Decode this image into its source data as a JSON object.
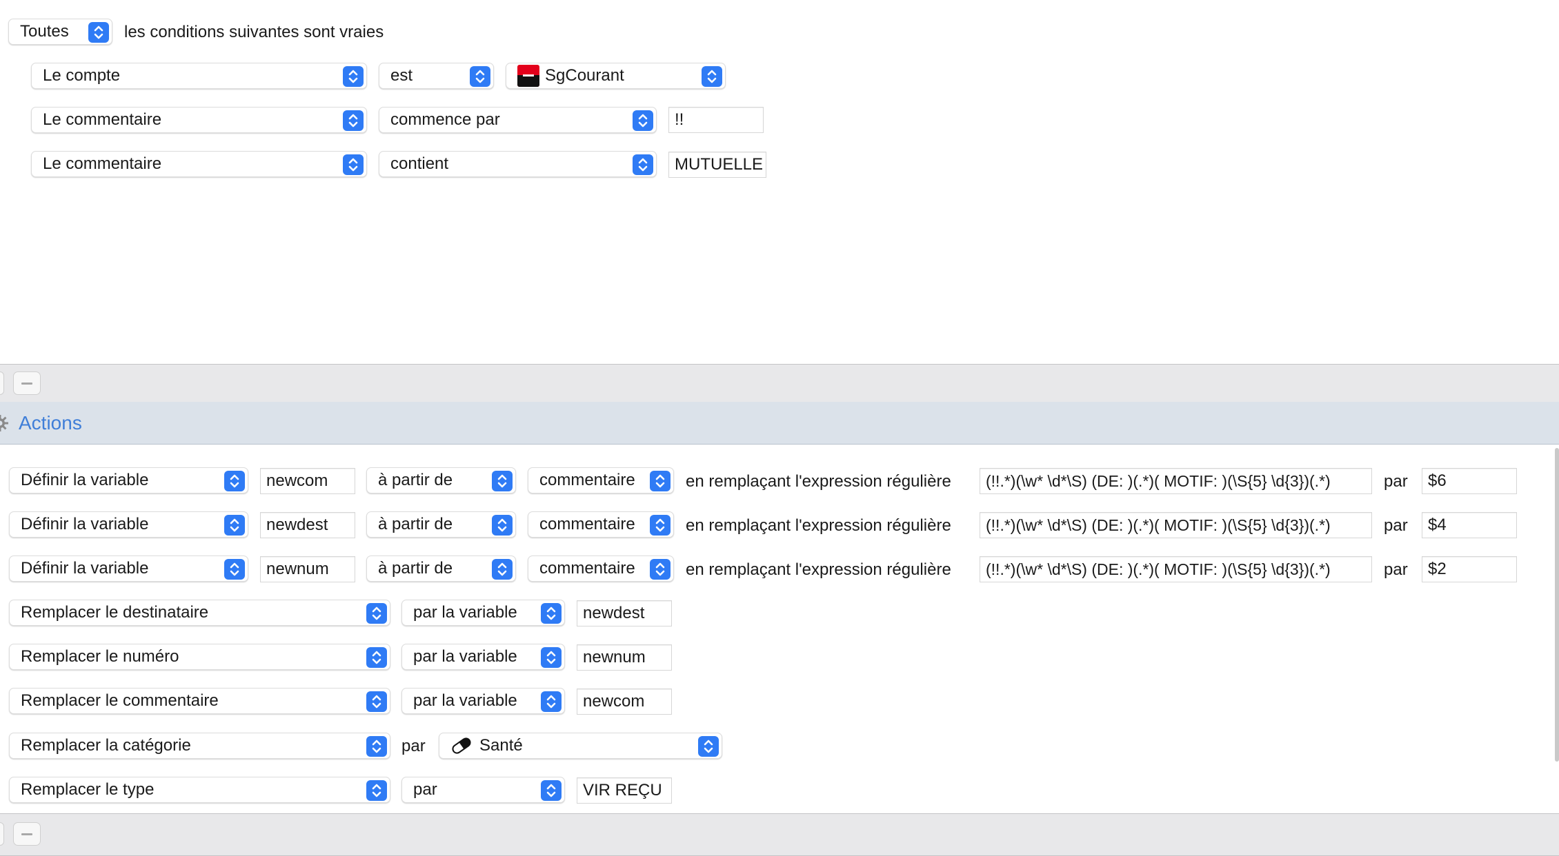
{
  "conditions": {
    "match_mode": "Toutes",
    "match_text": "les conditions suivantes sont vraies",
    "rows": [
      {
        "field": "Le compte",
        "operator": "est",
        "value": "SgCourant"
      },
      {
        "field": "Le commentaire",
        "operator": "commence par",
        "value": "!!"
      },
      {
        "field": "Le commentaire",
        "operator": "contient",
        "value": "MUTUELLE"
      }
    ]
  },
  "actions": {
    "title": "Actions",
    "variable_rows": [
      {
        "action": "Définir la variable",
        "name": "newcom",
        "source_mode": "à partir de",
        "source": "commentaire",
        "regex_label": "en remplaçant l'expression régulière",
        "regex": "(!!.*)(\\w* \\d*\\S) (DE: )(.*)( MOTIF: )(\\S{5} \\d{3})(.*)",
        "par_label": "par",
        "replacement": "$6"
      },
      {
        "action": "Définir la variable",
        "name": "newdest",
        "source_mode": "à partir de",
        "source": "commentaire",
        "regex_label": "en remplaçant l'expression régulière",
        "regex": "(!!.*)(\\w* \\d*\\S) (DE: )(.*)( MOTIF: )(\\S{5} \\d{3})(.*)",
        "par_label": "par",
        "replacement": "$4"
      },
      {
        "action": "Définir la variable",
        "name": "newnum",
        "source_mode": "à partir de",
        "source": "commentaire",
        "regex_label": "en remplaçant l'expression régulière",
        "regex": "(!!.*)(\\w* \\d*\\S) (DE: )(.*)( MOTIF: )(\\S{5} \\d{3})(.*)",
        "par_label": "par",
        "replacement": "$2"
      }
    ],
    "replace_rows": [
      {
        "action": "Remplacer le destinataire",
        "mode": "par la variable",
        "value": "newdest"
      },
      {
        "action": "Remplacer le numéro",
        "mode": "par la variable",
        "value": "newnum"
      },
      {
        "action": "Remplacer le commentaire",
        "mode": "par la variable",
        "value": "newcom"
      }
    ],
    "category_row": {
      "action": "Remplacer la catégorie",
      "par_label": "par",
      "category": "Santé"
    },
    "type_row": {
      "action": "Remplacer le type",
      "mode": "par",
      "value": "VIR REÇU"
    }
  },
  "colors": {
    "accent": "#2f7bf5",
    "section_header_bg": "#dbe2ea",
    "section_title": "#3f7ed8",
    "bank_logo_red": "#e3001b"
  },
  "icons": {
    "stepper": "chevron-up-down-icon",
    "remove": "minus-icon",
    "gear": "gear-icon",
    "category": "pill-icon",
    "bank": "bank-logo-icon"
  }
}
